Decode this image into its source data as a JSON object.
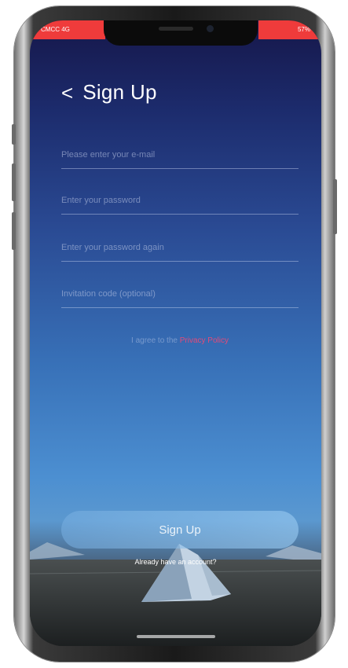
{
  "status": {
    "left": "CMCC 4G",
    "right": "57%"
  },
  "header": {
    "back_icon": "chevron-left-icon",
    "back_glyph": "<",
    "title": "Sign Up"
  },
  "form": {
    "email_placeholder": "Please enter your e-mail",
    "password_placeholder": "Enter your password",
    "password_again_placeholder": "Enter your password again",
    "invite_placeholder": "Invitation code (optional)"
  },
  "policy": {
    "agree_text": "I agree to the",
    "link_text": "Privacy Policy"
  },
  "signup_button": "Sign Up",
  "login_link": "Already have an account?",
  "colors": {
    "status_bar": "#ef3b3b",
    "policy_link": "#e24b7a",
    "background_top": "#16174a",
    "background_bottom": "#5b98cf"
  }
}
